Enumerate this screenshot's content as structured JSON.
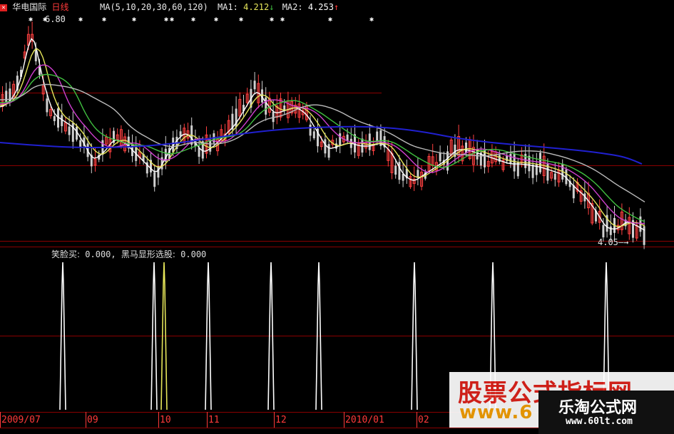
{
  "header": {
    "stock_name": "华电国际",
    "period": "日线",
    "ma_label": "MA(5,10,20,30,60,120)",
    "ma1_label": "MA1:",
    "ma1_value": "4.212",
    "ma1_arrow": "↓",
    "ma2_label": "MA2:",
    "ma2_value": "4.253",
    "ma2_arrow": "↑",
    "high_marker": "6.80",
    "colors": {
      "name": "#e8e8e8",
      "period": "#ff3a3a",
      "ma": "#e8e8e8",
      "ma2": "#ffffff"
    }
  },
  "price_panel": {
    "low_marker": "4.05"
  },
  "indicator": {
    "label1": "笑脸买:",
    "value1": "0.000,",
    "label2": "黑马显形选股:",
    "value2": "0.000"
  },
  "x_axis": {
    "labels": [
      "2009/07",
      "09",
      "10",
      "11",
      "12",
      "2010/01",
      "02"
    ]
  },
  "watermarks": {
    "brand_cn": "股票公式指标网",
    "brand_site_partial": "www.6",
    "brand2_cn": "乐淘公式网",
    "brand2_url": "www.60lt.com"
  },
  "colors": {
    "grid": "#8b0000",
    "candle": "#cfcfcf",
    "candle_up": "#ff4040",
    "ma_white": "#ffffff",
    "ma_yellow": "#e6e65a",
    "ma_magenta": "#d040d0",
    "ma_green": "#40c040",
    "ma_gray": "#bbbbbb",
    "ma_blue": "#2020d0",
    "signal": "#ffffff"
  }
}
